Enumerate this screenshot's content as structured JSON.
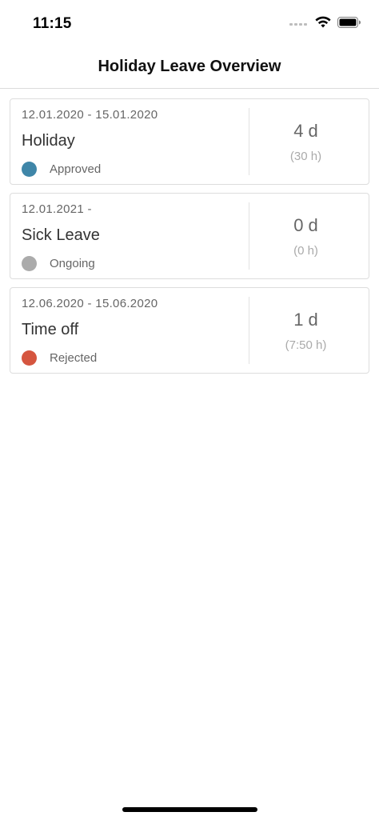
{
  "status_bar": {
    "time": "11:15",
    "icons": [
      "signal-icon",
      "wifi-icon",
      "battery-icon"
    ]
  },
  "nav": {
    "title": "Holiday Leave Overview"
  },
  "leave_requests": [
    {
      "date_range": "12.01.2020 - 15.01.2020",
      "type": "Holiday",
      "status": "Approved",
      "status_color": "#3f86a8",
      "days": "4 d",
      "hours": "(30 h)"
    },
    {
      "date_range": "12.01.2021 -",
      "type": "Sick Leave",
      "status": "Ongoing",
      "status_color": "#ababab",
      "days": "0 d",
      "hours": "(0 h)"
    },
    {
      "date_range": "12.06.2020 - 15.06.2020",
      "type": "Time off",
      "status": "Rejected",
      "status_color": "#d5553f",
      "days": "1 d",
      "hours": "(7:50 h)"
    }
  ]
}
